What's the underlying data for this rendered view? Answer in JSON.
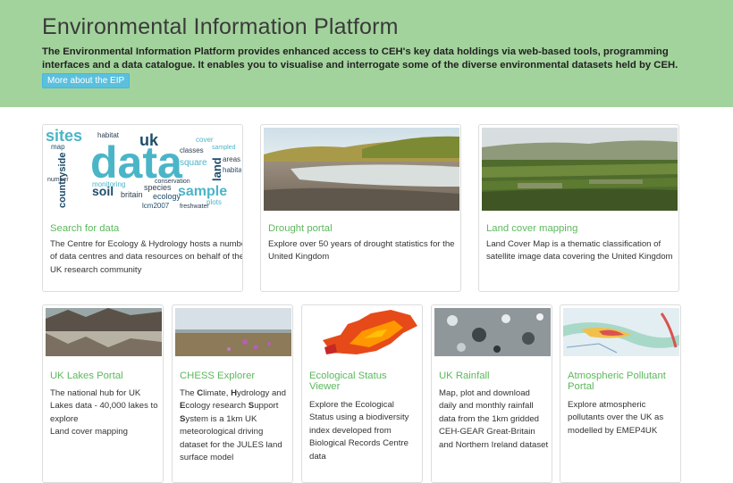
{
  "hero": {
    "title": "Environmental Information Platform",
    "description": "The Environmental Information Platform provides enhanced access to CEH's key data holdings via web-based tools, programming interfaces and a data catalogue. It enables you to visualise and interrogate some of the diverse environmental datasets held by CEH.",
    "more_button": "More about the EIP"
  },
  "colors": {
    "hero_bg": "#a2d39c",
    "title_green": "#5cb85c",
    "button_blue": "#5bc0de"
  },
  "cards_row1": [
    {
      "title": "Search for data",
      "text": "The Centre for Ecology & Hydrology hosts a number of data centres and data resources on behalf of the UK research community",
      "image": "word-cloud-image"
    },
    {
      "title": "Drought portal",
      "text": "Explore over 50 years of drought statistics for the United Kingdom",
      "image": "reservoir-image"
    },
    {
      "title": "Land cover mapping",
      "text": "Land Cover Map is a thematic classification of satellite image data covering the United Kingdom",
      "image": "landscape-image"
    }
  ],
  "word_cloud": {
    "big": "data",
    "words": [
      "sites",
      "habitat",
      "uk",
      "square",
      "sample",
      "soil",
      "britain",
      "ecology",
      "species",
      "cover",
      "classes",
      "monitoring",
      "lcm2007",
      "countryside",
      "land",
      "areas",
      "map",
      "plots",
      "number",
      "habitats",
      "conservation",
      "sampled",
      "freshwater"
    ]
  },
  "cards_row2": [
    {
      "title": "UK Lakes Portal",
      "text": "The national hub for UK Lakes data - 40,000 lakes to explore\nLand cover mapping"
    },
    {
      "title": "CHESS Explorer",
      "text_parts": [
        {
          "t": "The ",
          "b": false
        },
        {
          "t": "C",
          "b": true
        },
        {
          "t": "limate, ",
          "b": false
        },
        {
          "t": "H",
          "b": true
        },
        {
          "t": "ydrology and ",
          "b": false
        },
        {
          "t": "E",
          "b": true
        },
        {
          "t": "cology research ",
          "b": false
        },
        {
          "t": "S",
          "b": true
        },
        {
          "t": "upport ",
          "b": false
        },
        {
          "t": "S",
          "b": true
        },
        {
          "t": "ystem  is a 1km UK meteorological driving dataset for the JULES land surface model",
          "b": false
        }
      ]
    },
    {
      "title": "Ecological Status Viewer",
      "text": "Explore the Ecological Status using a biodiversity index developed from Biological Records Centre data"
    },
    {
      "title": "UK Rainfall",
      "text": "Map, plot and download daily and monthly rainfall data from the 1km gridded CEH-GEAR Great-Britain and Northern Ireland dataset"
    },
    {
      "title": "Atmospheric Pollutant Portal",
      "text": "Explore atmospheric pollutants over the UK as modelled by EMEP4UK"
    }
  ]
}
